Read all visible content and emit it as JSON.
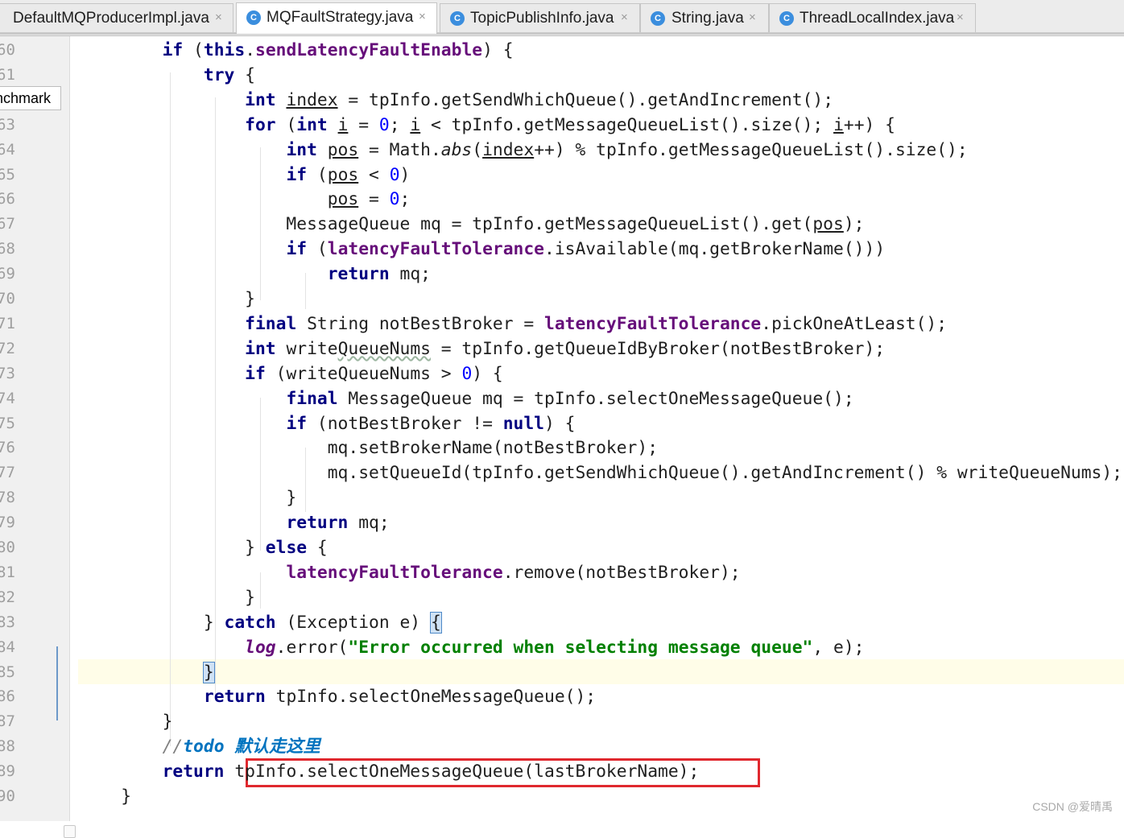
{
  "tabs": [
    {
      "name": "DefaultMQProducerImpl.java",
      "icon": "C",
      "active": false
    },
    {
      "name": "MQFaultStrategy.java",
      "icon": "C",
      "active": true
    },
    {
      "name": "TopicPublishInfo.java",
      "icon": "C",
      "active": false
    },
    {
      "name": "String.java",
      "icon": "C",
      "active": false
    },
    {
      "name": "ThreadLocalIndex.java",
      "icon": "C",
      "active": false
    }
  ],
  "tab_close_glyph": "×",
  "gutter": {
    "line_numbers": [
      "60",
      "61",
      "",
      "63",
      "64",
      "65",
      "66",
      "67",
      "68",
      "69",
      "70",
      "71",
      "72",
      "73",
      "74",
      "75",
      "76",
      "77",
      "78",
      "79",
      "80",
      "81",
      "82",
      "83",
      "84",
      "85",
      "86",
      "87",
      "88",
      "89",
      "90"
    ],
    "hint_label": "enchmark"
  },
  "code_lines": [
    [
      {
        "t": "        "
      },
      {
        "t": "if",
        "c": "kw"
      },
      {
        "t": " ("
      },
      {
        "t": "this",
        "c": "kw"
      },
      {
        "t": "."
      },
      {
        "t": "sendLatencyFaultEnable",
        "c": "fld"
      },
      {
        "t": ") {"
      }
    ],
    [
      {
        "t": "            "
      },
      {
        "t": "try",
        "c": "kw"
      },
      {
        "t": " {"
      }
    ],
    [
      {
        "t": "                "
      },
      {
        "t": "int",
        "c": "kw"
      },
      {
        "t": " "
      },
      {
        "t": "index",
        "c": "ul"
      },
      {
        "t": " = tpInfo.getSendWhichQueue().getAndIncrement();"
      }
    ],
    [
      {
        "t": "                "
      },
      {
        "t": "for",
        "c": "kw"
      },
      {
        "t": " ("
      },
      {
        "t": "int",
        "c": "kw"
      },
      {
        "t": " "
      },
      {
        "t": "i",
        "c": "ul"
      },
      {
        "t": " = "
      },
      {
        "t": "0",
        "c": "num"
      },
      {
        "t": "; "
      },
      {
        "t": "i",
        "c": "ul"
      },
      {
        "t": " < tpInfo.getMessageQueueList().size(); "
      },
      {
        "t": "i",
        "c": "ul"
      },
      {
        "t": "++) {"
      }
    ],
    [
      {
        "t": "                    "
      },
      {
        "t": "int",
        "c": "kw"
      },
      {
        "t": " "
      },
      {
        "t": "pos",
        "c": "ul"
      },
      {
        "t": " = Math."
      },
      {
        "t": "abs",
        "c": "ital"
      },
      {
        "t": "("
      },
      {
        "t": "index",
        "c": "ul"
      },
      {
        "t": "++) % tpInfo.getMessageQueueList().size();"
      }
    ],
    [
      {
        "t": "                    "
      },
      {
        "t": "if",
        "c": "kw"
      },
      {
        "t": " ("
      },
      {
        "t": "pos",
        "c": "ul"
      },
      {
        "t": " < "
      },
      {
        "t": "0",
        "c": "num"
      },
      {
        "t": ")"
      }
    ],
    [
      {
        "t": "                        "
      },
      {
        "t": "pos",
        "c": "ul"
      },
      {
        "t": " = "
      },
      {
        "t": "0",
        "c": "num"
      },
      {
        "t": ";"
      }
    ],
    [
      {
        "t": "                    MessageQueue mq = tpInfo.getMessageQueueList().get("
      },
      {
        "t": "pos",
        "c": "ul"
      },
      {
        "t": ");"
      }
    ],
    [
      {
        "t": "                    "
      },
      {
        "t": "if",
        "c": "kw"
      },
      {
        "t": " ("
      },
      {
        "t": "latencyFaultTolerance",
        "c": "fld"
      },
      {
        "t": ".isAvailable(mq.getBrokerName()))"
      }
    ],
    [
      {
        "t": "                        "
      },
      {
        "t": "return",
        "c": "kw"
      },
      {
        "t": " mq;"
      }
    ],
    [
      {
        "t": "                }"
      }
    ],
    [
      {
        "t": "                "
      },
      {
        "t": "final",
        "c": "kw"
      },
      {
        "t": " String notBestBroker = "
      },
      {
        "t": "latencyFaultTolerance",
        "c": "fld"
      },
      {
        "t": ".pickOneAtLeast();"
      }
    ],
    [
      {
        "t": "                "
      },
      {
        "t": "int",
        "c": "kw"
      },
      {
        "t": " write"
      },
      {
        "t": "QueueNums",
        "c": "wavy"
      },
      {
        "t": " = tpInfo.getQueueIdByBroker(notBestBroker);"
      }
    ],
    [
      {
        "t": "                "
      },
      {
        "t": "if",
        "c": "kw"
      },
      {
        "t": " (writeQueueNums > "
      },
      {
        "t": "0",
        "c": "num"
      },
      {
        "t": ") {"
      }
    ],
    [
      {
        "t": "                    "
      },
      {
        "t": "final",
        "c": "kw"
      },
      {
        "t": " MessageQueue mq = tpInfo.selectOneMessageQueue();"
      }
    ],
    [
      {
        "t": "                    "
      },
      {
        "t": "if",
        "c": "kw"
      },
      {
        "t": " (notBestBroker != "
      },
      {
        "t": "null",
        "c": "kw"
      },
      {
        "t": ") {"
      }
    ],
    [
      {
        "t": "                        mq.setBrokerName(notBestBroker);"
      }
    ],
    [
      {
        "t": "                        mq.setQueueId(tpInfo.getSendWhichQueue().getAndIncrement() % writeQueueNums);"
      }
    ],
    [
      {
        "t": "                    }"
      }
    ],
    [
      {
        "t": "                    "
      },
      {
        "t": "return",
        "c": "kw"
      },
      {
        "t": " mq;"
      }
    ],
    [
      {
        "t": "                } "
      },
      {
        "t": "else",
        "c": "kw"
      },
      {
        "t": " {"
      }
    ],
    [
      {
        "t": "                    "
      },
      {
        "t": "latencyFaultTolerance",
        "c": "fld"
      },
      {
        "t": ".remove(notBestBroker);"
      }
    ],
    [
      {
        "t": "                }"
      }
    ],
    [
      {
        "t": "            } "
      },
      {
        "t": "catch",
        "c": "kw"
      },
      {
        "t": " (Exception e) "
      },
      {
        "t": "{",
        "c": "brace-hl"
      }
    ],
    [
      {
        "t": "                "
      },
      {
        "t": "log",
        "c": "fld ital"
      },
      {
        "t": ".error("
      },
      {
        "t": "\"Error occurred when selecting message queue\"",
        "c": "str"
      },
      {
        "t": ", e);"
      }
    ],
    [
      {
        "t": "            "
      },
      {
        "t": "}",
        "c": "brace-hl"
      }
    ],
    [
      {
        "t": "            "
      },
      {
        "t": "return",
        "c": "kw"
      },
      {
        "t": " tpInfo.selectOneMessageQueue();"
      }
    ],
    [
      {
        "t": "        }"
      }
    ],
    [
      {
        "t": "        "
      },
      {
        "t": "//",
        "c": "cmt"
      },
      {
        "t": "todo",
        "c": "todo"
      },
      {
        "t": " 默认走这里",
        "c": "todo"
      }
    ],
    [
      {
        "t": "        "
      },
      {
        "t": "return",
        "c": "kw"
      },
      {
        "t": " tpInfo.selectOneMessageQueue(lastBrokerName);"
      }
    ],
    [
      {
        "t": "    }"
      }
    ]
  ],
  "watermark": "CSDN @爱晴禹",
  "colors": {
    "keyword": "#000080",
    "field": "#660e7a",
    "number": "#0000ff",
    "string": "#008000",
    "todo": "#0073bf",
    "highlight_box": "#e0282e"
  }
}
